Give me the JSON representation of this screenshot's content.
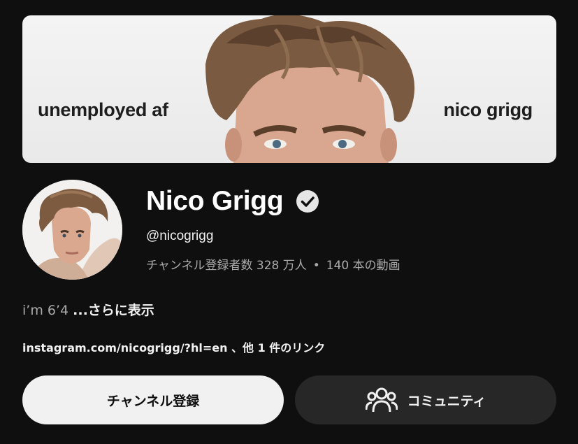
{
  "banner": {
    "left_text": "unemployed af",
    "right_text": "nico grigg"
  },
  "channel": {
    "name": "Nico Grigg",
    "verified_icon": "verified-check-icon",
    "handle": "@nicogrigg",
    "subscribers": "チャンネル登録者数 328 万人",
    "separator": "•",
    "videos": "140 本の動画"
  },
  "description": {
    "text": "i’m 6’4",
    "more": "...さらに表示"
  },
  "links": {
    "text": "instagram.com/nicogrigg/?hl=en 、他 1 件のリンク"
  },
  "actions": {
    "subscribe_label": "チャンネル登録",
    "community_label": "コミュニティ",
    "community_icon": "people-icon"
  },
  "colors": {
    "background": "#0f0f0f",
    "primary_button": "#f1f1f1",
    "secondary_button": "#272727",
    "muted_text": "#aaaaaa"
  }
}
